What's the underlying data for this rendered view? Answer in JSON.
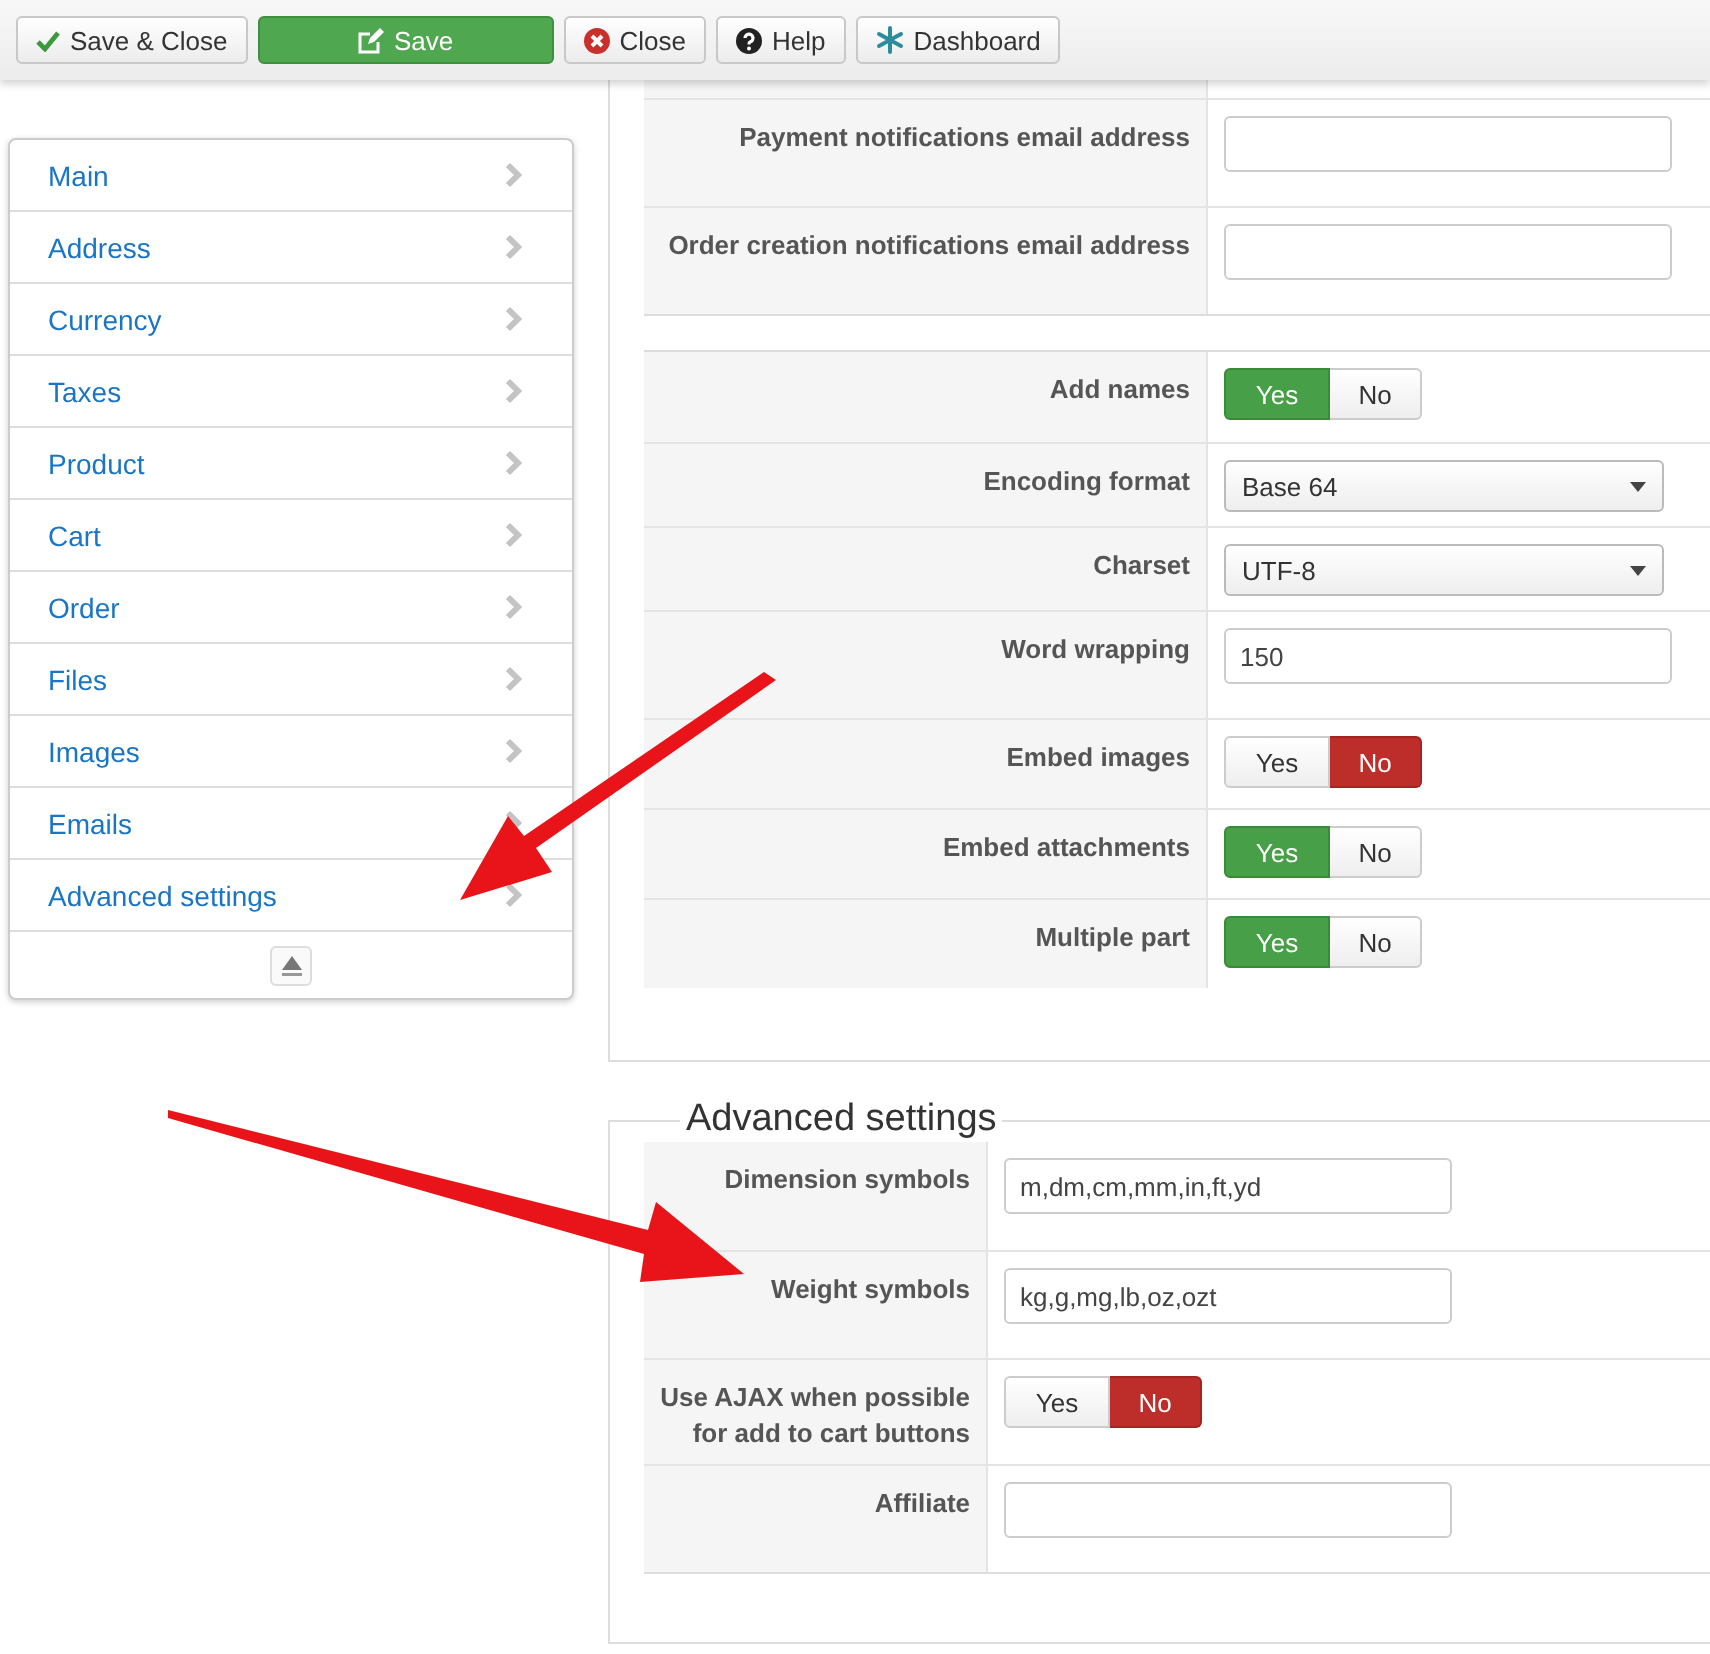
{
  "toolbar": {
    "buttons": [
      {
        "label": "Save & Close",
        "kind": "default"
      },
      {
        "label": "Save",
        "kind": "primary"
      },
      {
        "label": "Close",
        "kind": "default"
      },
      {
        "label": "Help",
        "kind": "default"
      },
      {
        "label": "Dashboard",
        "kind": "default"
      }
    ]
  },
  "sidebar": {
    "items": [
      {
        "label": "Main"
      },
      {
        "label": "Address"
      },
      {
        "label": "Currency"
      },
      {
        "label": "Taxes"
      },
      {
        "label": "Product"
      },
      {
        "label": "Cart"
      },
      {
        "label": "Order"
      },
      {
        "label": "Files"
      },
      {
        "label": "Images"
      },
      {
        "label": "Emails"
      },
      {
        "label": "Advanced settings"
      }
    ]
  },
  "email_settings": {
    "address_rows": [
      {
        "label": "Payment notifications email address",
        "kind": "input"
      },
      {
        "label": "Order creation notifications email address",
        "kind": "input"
      }
    ],
    "options_rows": [
      {
        "label": "Add names",
        "kind": "toggle",
        "options": [
          {
            "label": "Yes",
            "selected": true
          },
          {
            "label": "No",
            "selected": false
          }
        ]
      },
      {
        "label": "Encoding format",
        "kind": "select",
        "value": "Base 64"
      },
      {
        "label": "Charset",
        "kind": "select",
        "value": "UTF-8"
      },
      {
        "label": "Word wrapping",
        "kind": "input",
        "value": "150"
      },
      {
        "label": "Embed images",
        "kind": "toggle",
        "options": [
          {
            "label": "Yes",
            "selected": false
          },
          {
            "label": "No",
            "selected": true
          }
        ]
      },
      {
        "label": "Embed attachments",
        "kind": "toggle",
        "options": [
          {
            "label": "Yes",
            "selected": true
          },
          {
            "label": "No",
            "selected": false
          }
        ]
      },
      {
        "label": "Multiple part",
        "kind": "toggle",
        "options": [
          {
            "label": "Yes",
            "selected": true
          },
          {
            "label": "No",
            "selected": false
          }
        ]
      }
    ]
  },
  "advanced_settings": {
    "title": "Advanced settings",
    "rows": [
      {
        "label": "Dimension symbols",
        "kind": "input",
        "value": "m,dm,cm,mm,in,ft,yd"
      },
      {
        "label": "Weight symbols",
        "kind": "input",
        "value": "kg,g,mg,lb,oz,ozt"
      },
      {
        "label": "Use AJAX when possible for add to cart buttons",
        "kind": "toggle",
        "options": [
          {
            "label": "Yes",
            "selected": false
          },
          {
            "label": "No",
            "selected": true
          }
        ]
      },
      {
        "label": "Affiliate",
        "kind": "input"
      }
    ]
  }
}
